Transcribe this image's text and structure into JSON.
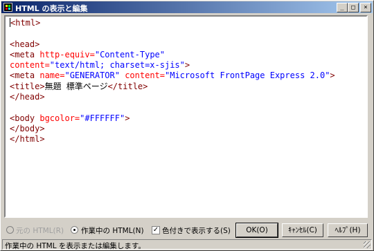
{
  "window": {
    "title": "HTML の表示と編集",
    "min_glyph": "_",
    "max_glyph": "□",
    "close_glyph": "×"
  },
  "colors": {
    "tag": "#800000",
    "attr_name": "#ff0000",
    "attr_value": "#0000ff",
    "text": "#000000",
    "title_active": "#0a246a"
  },
  "editor": {
    "lines": [
      [
        {
          "t": "<html>",
          "k": "tag"
        }
      ],
      [],
      [
        {
          "t": "<head>",
          "k": "tag"
        }
      ],
      [
        {
          "t": "<meta ",
          "k": "tag"
        },
        {
          "t": "http-equiv=",
          "k": "attr_name"
        },
        {
          "t": "\"Content-Type\"",
          "k": "attr_value"
        }
      ],
      [
        {
          "t": "content=",
          "k": "attr_name"
        },
        {
          "t": "\"text/html; charset=x-sjis\"",
          "k": "attr_value"
        },
        {
          "t": ">",
          "k": "tag"
        }
      ],
      [
        {
          "t": "<meta ",
          "k": "tag"
        },
        {
          "t": "name=",
          "k": "attr_name"
        },
        {
          "t": "\"GENERATOR\"",
          "k": "attr_value"
        },
        {
          "t": " content=",
          "k": "attr_name"
        },
        {
          "t": "\"Microsoft FrontPage Express 2.0\"",
          "k": "attr_value"
        },
        {
          "t": ">",
          "k": "tag"
        }
      ],
      [
        {
          "t": "<title>",
          "k": "tag"
        },
        {
          "t": "無題 標準ページ",
          "k": "text"
        },
        {
          "t": "</title>",
          "k": "tag"
        }
      ],
      [
        {
          "t": "</head>",
          "k": "tag"
        }
      ],
      [],
      [
        {
          "t": "<body ",
          "k": "tag"
        },
        {
          "t": "bgcolor=",
          "k": "attr_name"
        },
        {
          "t": "\"#FFFFFF\"",
          "k": "attr_value"
        },
        {
          "t": ">",
          "k": "tag"
        }
      ],
      [
        {
          "t": "</body>",
          "k": "tag"
        }
      ],
      [
        {
          "t": "</html>",
          "k": "tag"
        }
      ]
    ]
  },
  "options": {
    "original_html_label": "元の HTML(R)",
    "current_html_label": "作業中の HTML(N)",
    "color_display_label": "色付きで表示する(S)",
    "color_display_checked": true,
    "selected_view": "current"
  },
  "buttons": {
    "ok": "OK(O)",
    "cancel": "ｷｬﾝｾﾙ(C)",
    "help": "ﾍﾙﾌﾟ(H)"
  },
  "status": {
    "text": "作業中の HTML を表示または編集します。"
  }
}
